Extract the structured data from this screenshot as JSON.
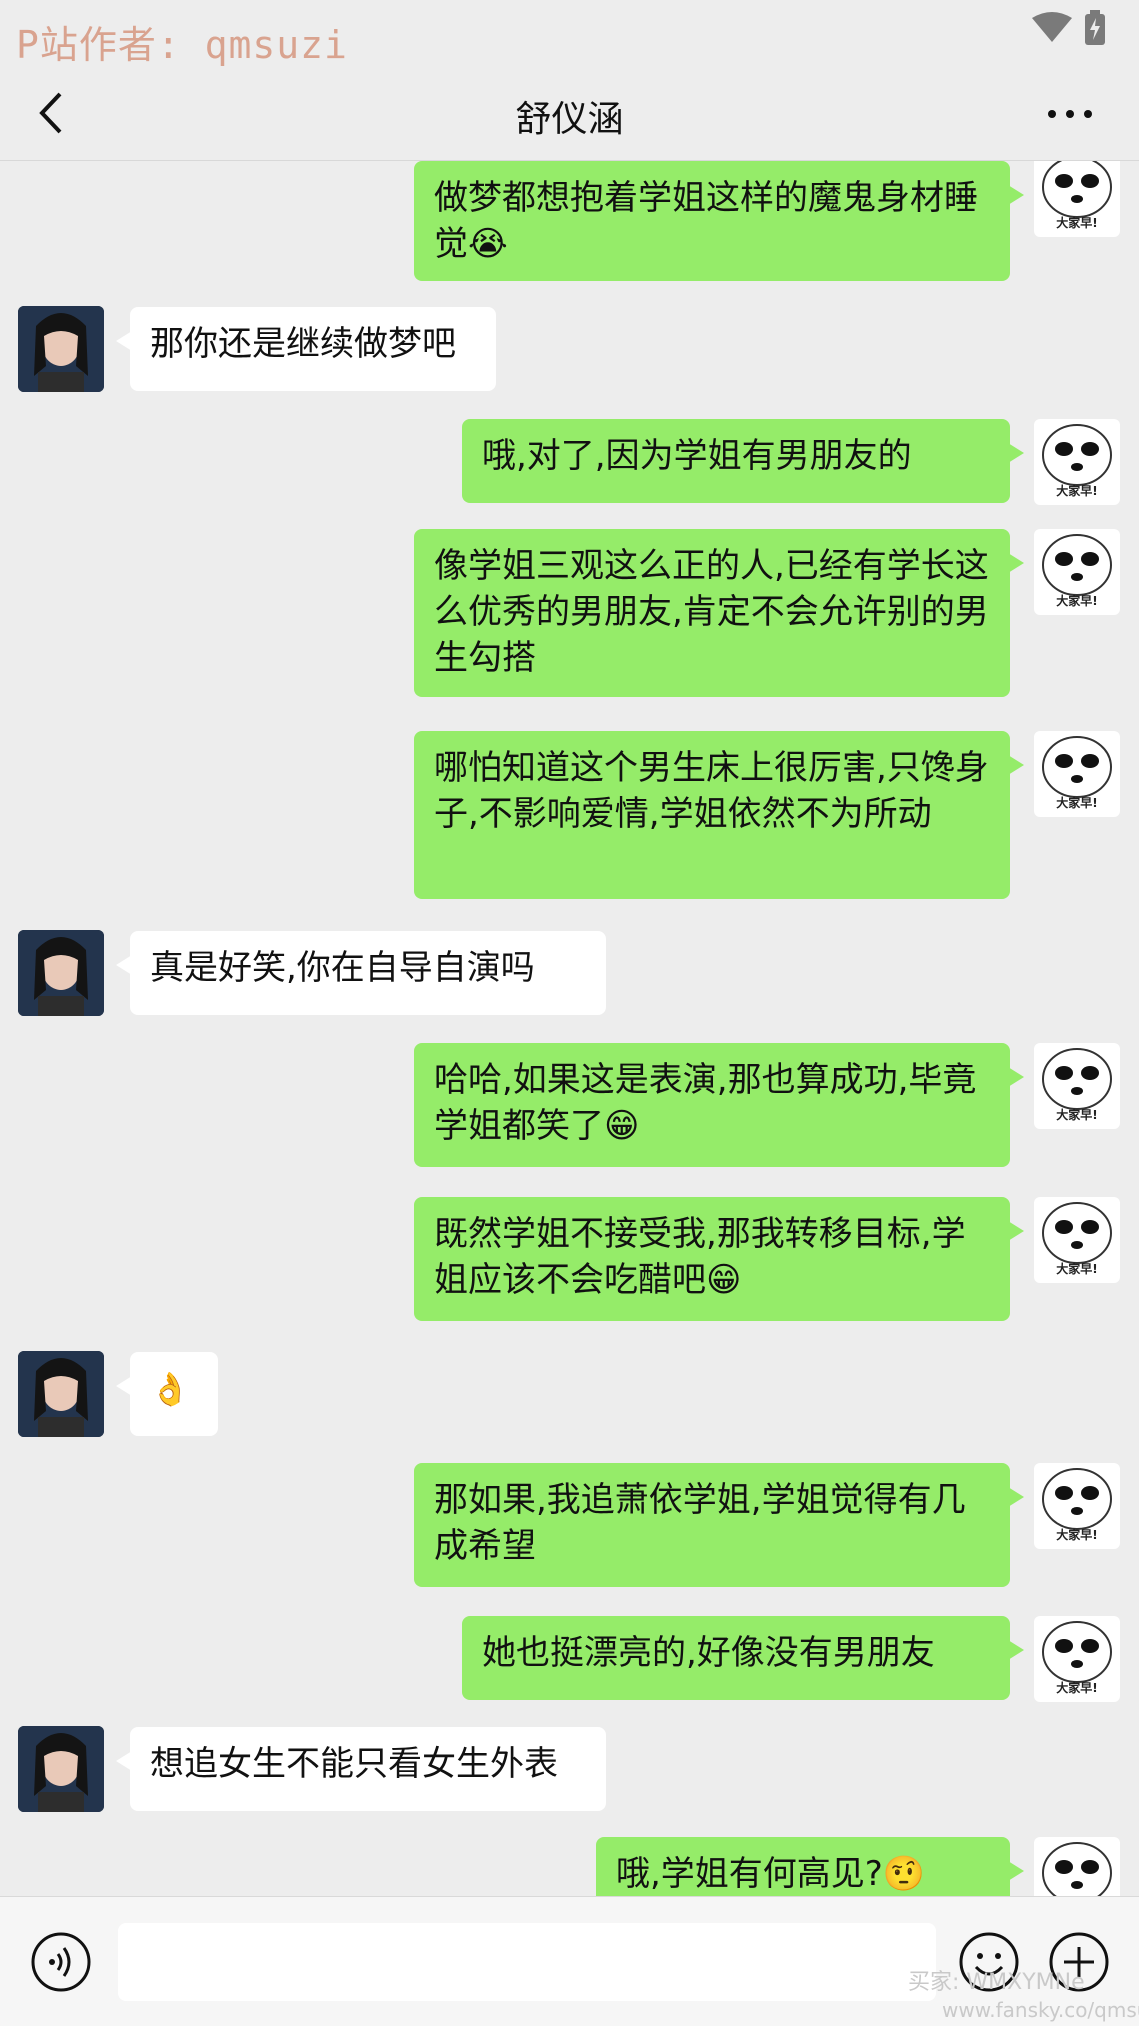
{
  "statusbar": {
    "watermark": "P站作者: qmsuzi"
  },
  "header": {
    "title": "舒仪涵"
  },
  "messages": [
    {
      "side": "out",
      "text": "做梦都想抱着学姐这样的魔鬼身材睡觉😭"
    },
    {
      "side": "in",
      "text": "那你还是继续做梦吧"
    },
    {
      "side": "out",
      "text": "哦,对了,因为学姐有男朋友的"
    },
    {
      "side": "out",
      "text": "像学姐三观这么正的人,已经有学长这么优秀的男朋友,肯定不会允许别的男生勾搭"
    },
    {
      "side": "out",
      "text": "哪怕知道这个男生床上很厉害,只馋身子,不影响爱情,学姐依然不为所动"
    },
    {
      "side": "in",
      "text": "真是好笑,你在自导自演吗"
    },
    {
      "side": "out",
      "text": "哈哈,如果这是表演,那也算成功,毕竟学姐都笑了😁"
    },
    {
      "side": "out",
      "text": "既然学姐不接受我,那我转移目标,学姐应该不会吃醋吧😁"
    },
    {
      "side": "in",
      "text": "👌"
    },
    {
      "side": "out",
      "text": "那如果,我追萧依学姐,学姐觉得有几成希望"
    },
    {
      "side": "out",
      "text": "她也挺漂亮的,好像没有男朋友"
    },
    {
      "side": "in",
      "text": "想追女生不能只看女生外表"
    },
    {
      "side": "out",
      "text": "哦,学姐有何高见?🤨"
    }
  ],
  "sticker_avatar_caption": "大家早!",
  "watermark_bottom": {
    "line1": "买家: WMXYMNe",
    "line2": "www.fansky.co/qmsuzi"
  },
  "icons": {
    "back": "back-arrow-icon",
    "more": "more-icon",
    "voice": "voice-icon",
    "sticker": "sticker-icon",
    "plus": "plus-icon",
    "wifi": "wifi-icon",
    "battery": "battery-icon"
  },
  "colors": {
    "bubble_out": "#95ec69",
    "bubble_in": "#ffffff",
    "background": "#ededed"
  }
}
